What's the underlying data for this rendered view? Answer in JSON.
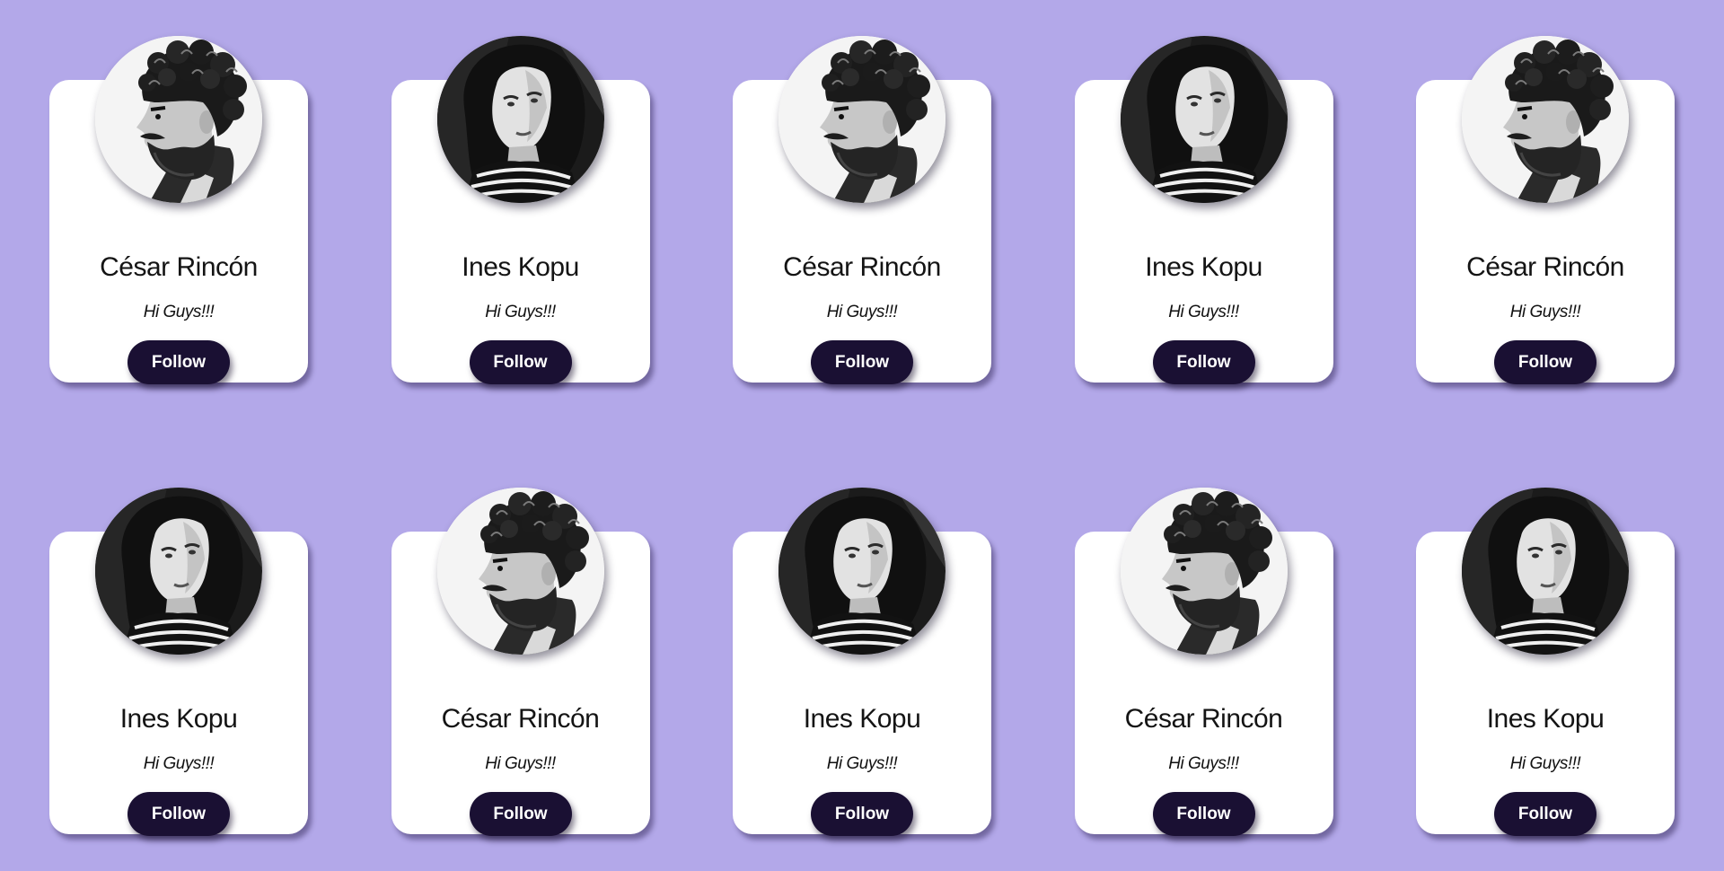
{
  "colors": {
    "background": "#b3a8e9",
    "card": "#ffffff",
    "button": "#1a1033",
    "button_text": "#ffffff"
  },
  "cards": [
    {
      "name": "César Rincón",
      "bio": "Hi Guys!!!",
      "button_label": "Follow",
      "avatar": "bearded-man-curly-hair-portrait"
    },
    {
      "name": "Ines Kopu",
      "bio": "Hi Guys!!!",
      "button_label": "Follow",
      "avatar": "woman-striped-shirt-portrait"
    },
    {
      "name": "César Rincón",
      "bio": "Hi Guys!!!",
      "button_label": "Follow",
      "avatar": "bearded-man-curly-hair-portrait"
    },
    {
      "name": "Ines Kopu",
      "bio": "Hi Guys!!!",
      "button_label": "Follow",
      "avatar": "woman-striped-shirt-portrait"
    },
    {
      "name": "César Rincón",
      "bio": "Hi Guys!!!",
      "button_label": "Follow",
      "avatar": "bearded-man-curly-hair-portrait"
    },
    {
      "name": "Ines Kopu",
      "bio": "Hi Guys!!!",
      "button_label": "Follow",
      "avatar": "woman-striped-shirt-portrait"
    },
    {
      "name": "César Rincón",
      "bio": "Hi Guys!!!",
      "button_label": "Follow",
      "avatar": "bearded-man-curly-hair-portrait"
    },
    {
      "name": "Ines Kopu",
      "bio": "Hi Guys!!!",
      "button_label": "Follow",
      "avatar": "woman-striped-shirt-portrait"
    },
    {
      "name": "César Rincón",
      "bio": "Hi Guys!!!",
      "button_label": "Follow",
      "avatar": "bearded-man-curly-hair-portrait"
    },
    {
      "name": "Ines Kopu",
      "bio": "Hi Guys!!!",
      "button_label": "Follow",
      "avatar": "woman-striped-shirt-portrait"
    }
  ]
}
